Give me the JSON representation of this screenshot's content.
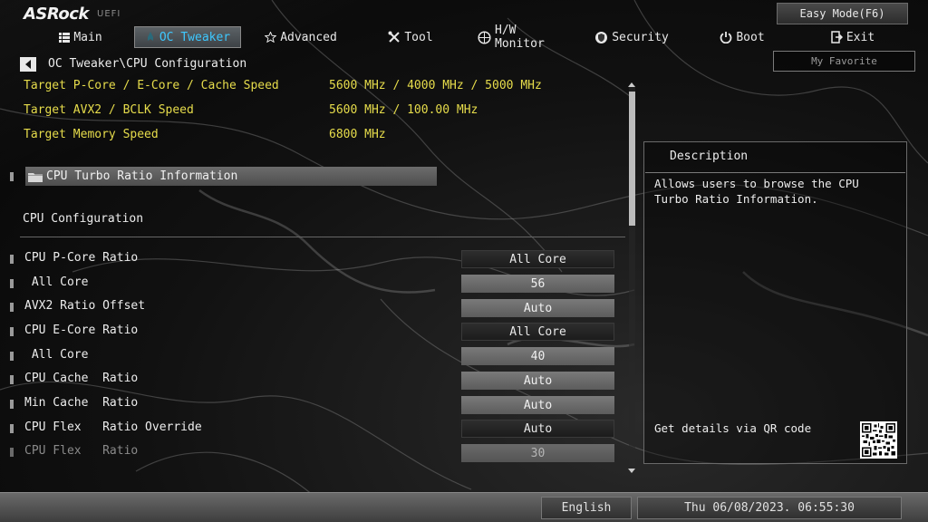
{
  "brand": {
    "logo": "ASRock",
    "suffix": "UEFI"
  },
  "top_buttons": {
    "easy_mode": "Easy Mode(F6)",
    "my_favorite": "My Favorite"
  },
  "tabs": [
    {
      "label": "Main",
      "icon": "list-icon",
      "active": false
    },
    {
      "label": "OC Tweaker",
      "icon": "rocket-icon",
      "active": true
    },
    {
      "label": "Advanced",
      "icon": "star-icon",
      "active": false
    },
    {
      "label": "Tool",
      "icon": "tools-icon",
      "active": false
    },
    {
      "label": "H/W Monitor",
      "icon": "monitor-icon",
      "active": false
    },
    {
      "label": "Security",
      "icon": "shield-icon",
      "active": false
    },
    {
      "label": "Boot",
      "icon": "power-icon",
      "active": false
    },
    {
      "label": "Exit",
      "icon": "exit-icon",
      "active": false
    }
  ],
  "breadcrumb": "OC Tweaker\\CPU Configuration",
  "targets": [
    {
      "label": "Target P-Core / E-Core / Cache Speed",
      "value": "5600 MHz / 4000 MHz / 5000 MHz"
    },
    {
      "label": "Target AVX2 / BCLK Speed",
      "value": "5600 MHz / 100.00 MHz"
    },
    {
      "label": "Target Memory Speed",
      "value": "6800 MHz"
    }
  ],
  "folder_item": {
    "label": "CPU Turbo Ratio Information",
    "icon": "folder-icon"
  },
  "section_title": "CPU Configuration",
  "settings": [
    {
      "label": "CPU P-Core Ratio",
      "value": "All Core"
    },
    {
      "label": " All Core",
      "value": "56"
    },
    {
      "label": "AVX2 Ratio Offset",
      "value": "Auto"
    },
    {
      "label": "CPU E-Core Ratio",
      "value": "All Core"
    },
    {
      "label": " All Core",
      "value": "40"
    },
    {
      "label": "CPU Cache  Ratio",
      "value": "Auto"
    },
    {
      "label": "Min Cache  Ratio",
      "value": "Auto"
    },
    {
      "label": "CPU Flex   Ratio Override",
      "value": "Auto"
    },
    {
      "label": "CPU Flex   Ratio",
      "value": "30"
    }
  ],
  "description": {
    "title": "Description",
    "text": "Allows users to browse the CPU Turbo Ratio Information.",
    "qr_label": "Get details via QR code"
  },
  "footer": {
    "language": "English",
    "datetime": "Thu 06/08/2023. 06:55:30"
  },
  "colors": {
    "accent": "#3ec8ff",
    "highlight_text": "#e6dc4b"
  }
}
